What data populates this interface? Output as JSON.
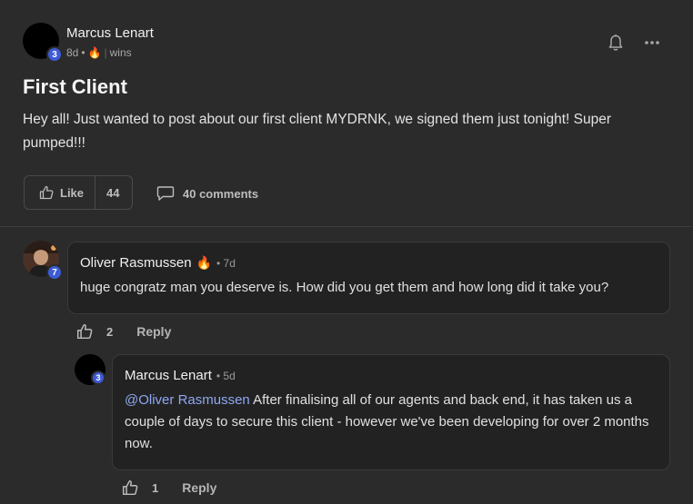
{
  "post": {
    "author": {
      "name": "Marcus Lenart",
      "level": "3"
    },
    "meta": {
      "time": "8d",
      "dot": "•",
      "flame": "🔥",
      "separator": "|",
      "category": "wins"
    },
    "title": "First Client",
    "body": "Hey all! Just wanted to post about our first client MYDRNK, we signed them just tonight! Super pumped!!!",
    "like_label": "Like",
    "like_count": "44",
    "comments_label": "40 comments",
    "icons": {
      "bell": "bell-icon",
      "more": "more-icon",
      "like": "thumbs-up-icon",
      "comment": "comment-icon"
    }
  },
  "comments": [
    {
      "author": "Oliver Rasmussen",
      "flame": "🔥",
      "time": "• 7d",
      "level": "7",
      "text": "huge congratz man you deserve is. How did you get them and how long did it take you?",
      "likes": "2",
      "reply_label": "Reply"
    }
  ],
  "reply": {
    "author": "Marcus Lenart",
    "time": "• 5d",
    "level": "3",
    "mention": "@Oliver Rasmussen",
    "text": " After finalising all of our agents and back end, it has taken us a couple of days to secure this client - however we've been developing for over 2 months now.",
    "likes": "1",
    "reply_label": "Reply"
  },
  "colors": {
    "background": "#2b2b2b",
    "bubble": "#222222",
    "mention": "#8fa8f2",
    "badge": "#3e5bd6"
  }
}
